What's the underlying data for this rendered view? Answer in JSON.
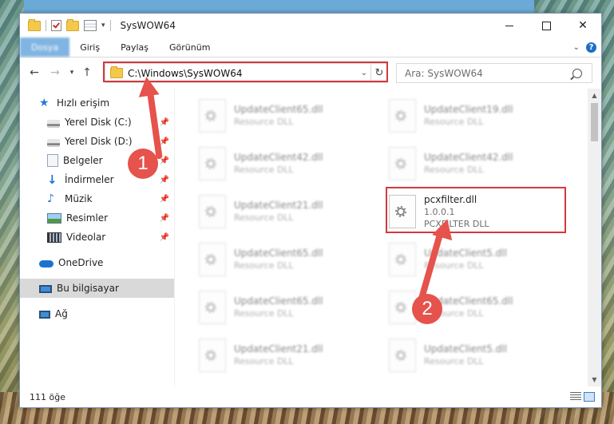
{
  "window": {
    "title": "SysWOW64"
  },
  "ribbon": {
    "tabs": [
      "Dosya",
      "Giriş",
      "Paylaş",
      "Görünüm"
    ]
  },
  "navbar": {
    "address": "C:\\Windows\\SysWOW64",
    "search_placeholder": "Ara: SysWOW64"
  },
  "sidebar": {
    "quick_access": "Hızlı erişim",
    "pinned": [
      "Yerel Disk (C:)",
      "Yerel Disk (D:)",
      "Belgeler",
      "İndirmeler",
      "Müzik",
      "Resimler",
      "Videolar"
    ],
    "onedrive": "OneDrive",
    "this_pc": "Bu bilgisayar",
    "network": "Ağ"
  },
  "files": [
    {
      "name": "UpdateClient65.dll",
      "sub": "Resource DLL"
    },
    {
      "name": "UpdateClient19.dll",
      "sub": "Resource DLL"
    },
    {
      "name": "UpdateClient42.dll",
      "sub": "Resource DLL"
    },
    {
      "name": "UpdateClient42.dll",
      "sub": "Resource DLL"
    },
    {
      "name": "UpdateClient21.dll",
      "sub": "Resource DLL"
    },
    {
      "name": "pcxfilter.dll",
      "version": "1.0.0.1",
      "sub": "PCXFILTER DLL"
    },
    {
      "name": "UpdateClient65.dll",
      "sub": "Resource DLL"
    },
    {
      "name": "UpdateClient5.dll",
      "sub": "Resource DLL"
    },
    {
      "name": "UpdateClient65.dll",
      "sub": "Resource DLL"
    },
    {
      "name": "UpdateClient65.dll",
      "sub": "Resource DLL"
    },
    {
      "name": "UpdateClient21.dll",
      "sub": "Resource DLL"
    },
    {
      "name": "UpdateClient5.dll",
      "sub": "Resource DLL"
    }
  ],
  "status": {
    "count": "111 öğe"
  },
  "annotations": {
    "step1": "1",
    "step2": "2",
    "color": "#e6524c"
  }
}
